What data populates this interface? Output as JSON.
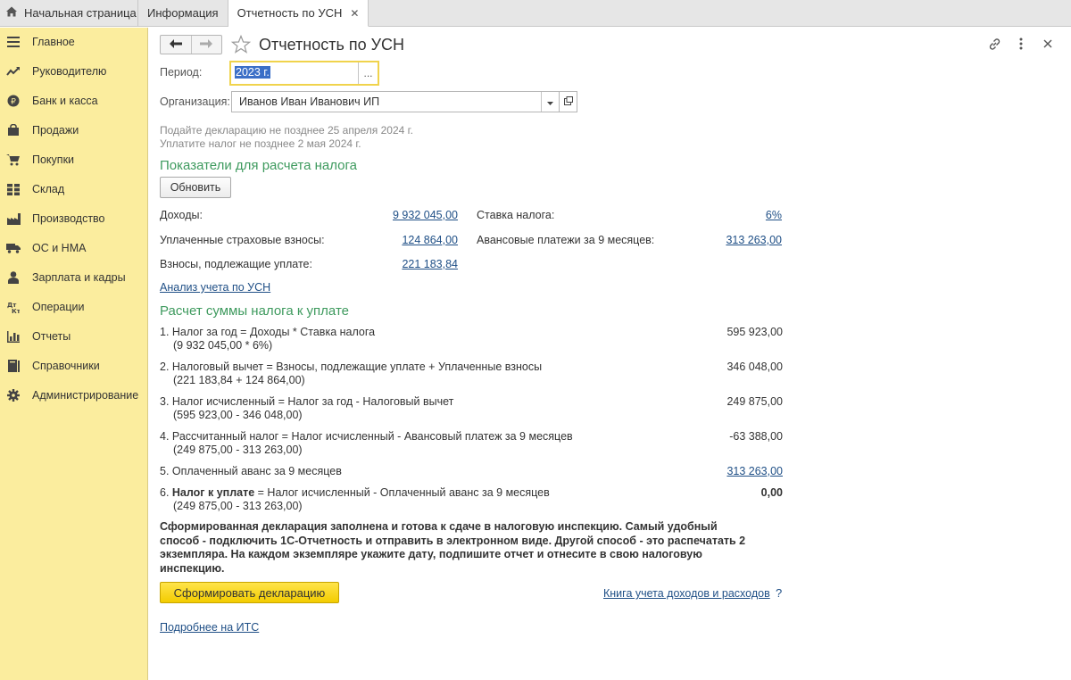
{
  "tabs": {
    "home": "Начальная страница",
    "items": [
      {
        "label": "Информация",
        "closable": false
      },
      {
        "label": "Отчетность по УСН",
        "closable": true,
        "close": "✕"
      }
    ]
  },
  "sidebar": {
    "items": [
      {
        "label": "Главное",
        "icon": "menu-icon"
      },
      {
        "label": "Руководителю",
        "icon": "trend-icon"
      },
      {
        "label": "Банк и касса",
        "icon": "ruble-icon"
      },
      {
        "label": "Продажи",
        "icon": "bag-icon"
      },
      {
        "label": "Покупки",
        "icon": "cart-icon"
      },
      {
        "label": "Склад",
        "icon": "grid-icon"
      },
      {
        "label": "Производство",
        "icon": "factory-icon"
      },
      {
        "label": "ОС и НМА",
        "icon": "truck-icon"
      },
      {
        "label": "Зарплата и кадры",
        "icon": "person-icon"
      },
      {
        "label": "Операции",
        "icon": "operations-icon"
      },
      {
        "label": "Отчеты",
        "icon": "bar-chart-icon"
      },
      {
        "label": "Справочники",
        "icon": "book-icon"
      },
      {
        "label": "Администрирование",
        "icon": "gear-icon"
      }
    ]
  },
  "header": {
    "title": "Отчетность по УСН"
  },
  "form": {
    "period_label": "Период:",
    "period_value": "2023 г.",
    "period_button": "...",
    "org_label": "Организация:",
    "org_value": "Иванов Иван Иванович ИП",
    "note1": "Подайте декларацию не позднее 25 апреля 2024 г.",
    "note2": "Уплатите налог не позднее 2 мая 2024 г."
  },
  "indicators": {
    "title": "Показатели для расчета налога",
    "refresh": "Обновить",
    "income_label": "Доходы:",
    "income_value": "9 932 045,00",
    "paid_ins_label": "Уплаченные страховые взносы:",
    "paid_ins_value": "124 864,00",
    "due_ins_label": "Взносы, подлежащие уплате:",
    "due_ins_value": "221 183,84",
    "rate_label": "Ставка налога:",
    "rate_value": "6%",
    "advance_label": "Авансовые платежи за 9 месяцев:",
    "advance_value": "313 263,00",
    "analysis_link": "Анализ учета по УСН"
  },
  "calc": {
    "title": "Расчет суммы налога к уплате",
    "rows": [
      {
        "line": "1. Налог за год = Доходы * Ставка налога",
        "sub": "(9 932 045,00 * 6%)",
        "amount": "595 923,00"
      },
      {
        "line": "2. Налоговый вычет = Взносы, подлежащие уплате + Уплаченные взносы",
        "sub": "(221 183,84 + 124 864,00)",
        "amount": "346 048,00"
      },
      {
        "line": "3. Налог исчисленный = Налог за год - Налоговый вычет",
        "sub": "(595 923,00 - 346 048,00)",
        "amount": "249 875,00"
      },
      {
        "line": "4. Рассчитанный налог = Налог исчисленный - Авансовый платеж за 9 месяцев",
        "sub": "(249 875,00 - 313 263,00)",
        "amount": "-63 388,00"
      },
      {
        "line": "5. Оплаченный аванс за 9 месяцев",
        "amount": "313 263,00"
      }
    ],
    "row6_prefix": "6. ",
    "row6_bold": "Налог к уплате",
    "row6_rest": " = Налог исчисленный - Оплаченный аванс за 9 месяцев",
    "row6_sub": "(249 875,00 - 313 263,00)",
    "row6_amount": "0,00"
  },
  "footer": {
    "message": "Сформированная декларация заполнена и готова к сдаче в налоговую инспекцию. Самый удобный способ - подключить 1С-Отчетность и отправить в электронном виде. Другой способ - это распечатать 2 экземпляра. На каждом экземпляре укажите дату, подпишите отчет и отнесите в свою налоговую инспекцию.",
    "generate": "Сформировать декларацию",
    "ledger_link": "Книга учета доходов и расходов",
    "help": "?",
    "its_link": "Подробнее на ИТС"
  }
}
